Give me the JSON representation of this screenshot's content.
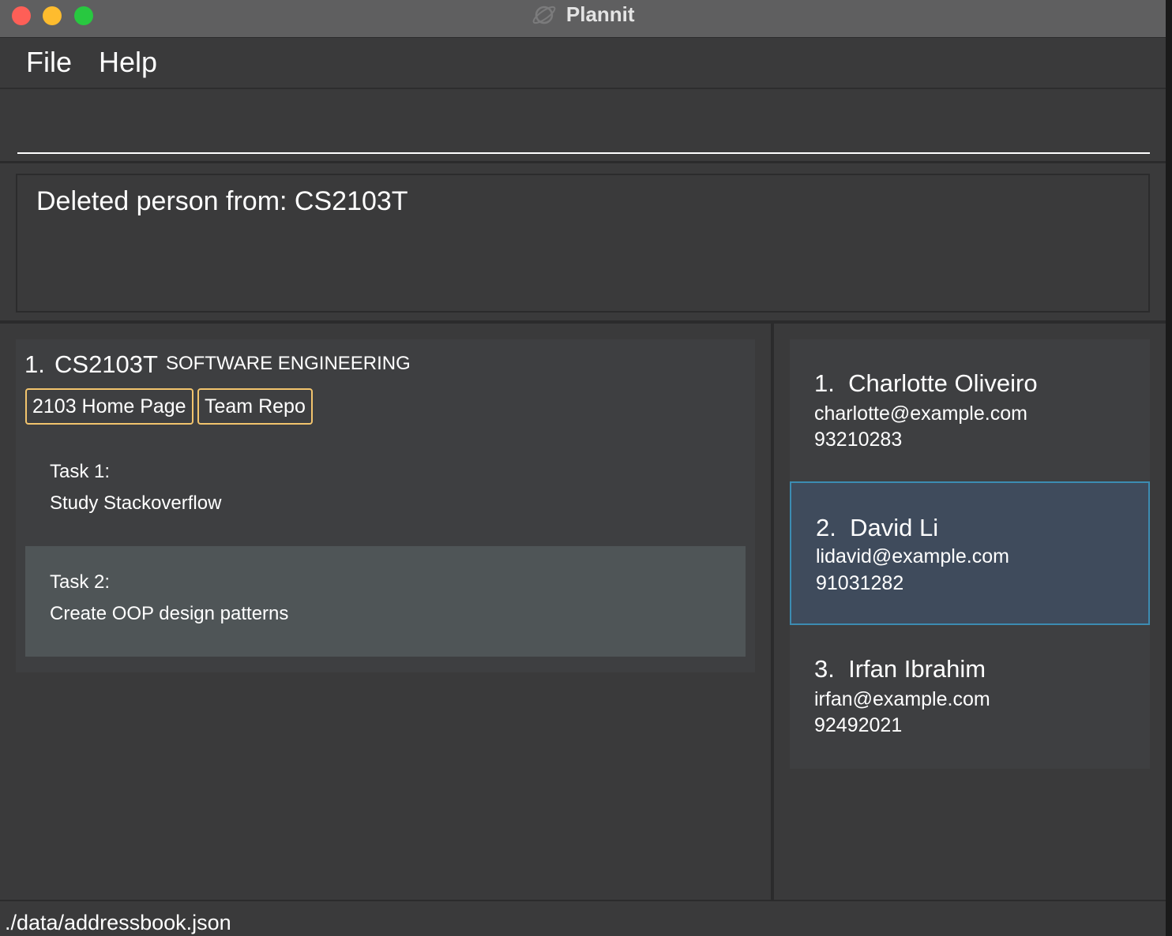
{
  "window": {
    "title": "Plannit",
    "icon": "planet-icon",
    "traffic_lights": {
      "close": "#fe5f57",
      "minimize": "#febc2e",
      "maximize": "#28c840"
    }
  },
  "menu": {
    "file": "File",
    "help": "Help"
  },
  "command": {
    "value": "",
    "placeholder": ""
  },
  "result": {
    "message": "Deleted person from: CS2103T"
  },
  "modules": [
    {
      "index": "1.",
      "code": "CS2103T",
      "name": "SOFTWARE ENGINEERING",
      "links": [
        "2103 Home Page",
        "Team Repo"
      ],
      "tasks": [
        {
          "label": "Task 1:",
          "description": "Study Stackoverflow",
          "selected": false
        },
        {
          "label": "Task 2:",
          "description": "Create OOP design patterns",
          "selected": true
        }
      ]
    }
  ],
  "persons": [
    {
      "index": "1.",
      "name": "Charlotte Oliveiro",
      "email": "charlotte@example.com",
      "phone": "93210283",
      "selected": false
    },
    {
      "index": "2.",
      "name": "David Li",
      "email": "lidavid@example.com",
      "phone": "91031282",
      "selected": true
    },
    {
      "index": "3.",
      "name": "Irfan Ibrahim",
      "email": "irfan@example.com",
      "phone": "92492021",
      "selected": false
    }
  ],
  "status": {
    "file_path": "./data/addressbook.json"
  },
  "colors": {
    "background": "#3a3a3b",
    "card": "#3e3f41",
    "selected_task": "#4f5557",
    "selected_person": "#3f4b5c",
    "selected_border": "#3c8cb2",
    "link_border": "#f2c46d"
  }
}
